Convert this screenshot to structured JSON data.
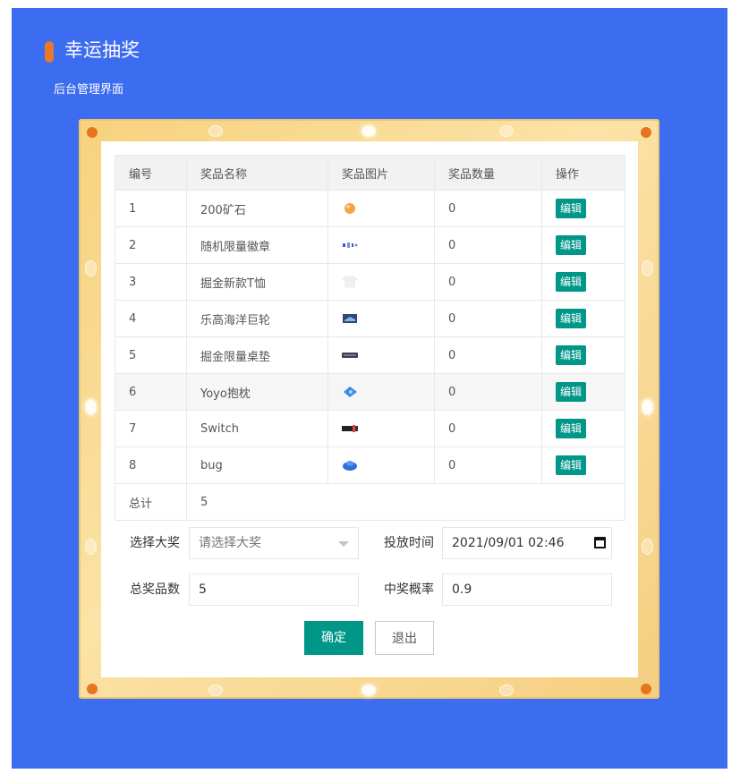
{
  "header": {
    "title": "幸运抽奖",
    "subtitle": "后台管理界面"
  },
  "table": {
    "columns": [
      "编号",
      "奖品名称",
      "奖品图片",
      "奖品数量",
      "操作"
    ],
    "rows": [
      {
        "id": "1",
        "name": "200矿石",
        "image_icon": "ore-icon",
        "qty": "0",
        "action": "编辑"
      },
      {
        "id": "2",
        "name": "随机限量徽章",
        "image_icon": "badge-icon",
        "qty": "0",
        "action": "编辑"
      },
      {
        "id": "3",
        "name": "掘金新款T恤",
        "image_icon": "tshirt-icon",
        "qty": "0",
        "action": "编辑"
      },
      {
        "id": "4",
        "name": "乐高海洋巨轮",
        "image_icon": "lego-ship-icon",
        "qty": "0",
        "action": "编辑"
      },
      {
        "id": "5",
        "name": "掘金限量桌垫",
        "image_icon": "desk-mat-icon",
        "qty": "0",
        "action": "编辑"
      },
      {
        "id": "6",
        "name": "Yoyo抱枕",
        "image_icon": "pillow-icon",
        "qty": "0",
        "action": "编辑"
      },
      {
        "id": "7",
        "name": "Switch",
        "image_icon": "switch-icon",
        "qty": "0",
        "action": "编辑"
      },
      {
        "id": "8",
        "name": "bug",
        "image_icon": "bug-icon",
        "qty": "0",
        "action": "编辑"
      }
    ],
    "total_label": "总计",
    "total_value": "5"
  },
  "form": {
    "prize_label": "选择大奖",
    "prize_placeholder": "请选择大奖",
    "time_label": "投放时间",
    "time_value": "2021/09/01 02:46",
    "count_label": "总奖品数",
    "count_value": "5",
    "rate_label": "中奖概率",
    "rate_value": "0.9"
  },
  "buttons": {
    "confirm": "确定",
    "exit": "退出"
  },
  "colors": {
    "background": "#3c6cef",
    "accent": "#009688",
    "title_pill": "#e8782a",
    "frame": "#f7d27e"
  }
}
